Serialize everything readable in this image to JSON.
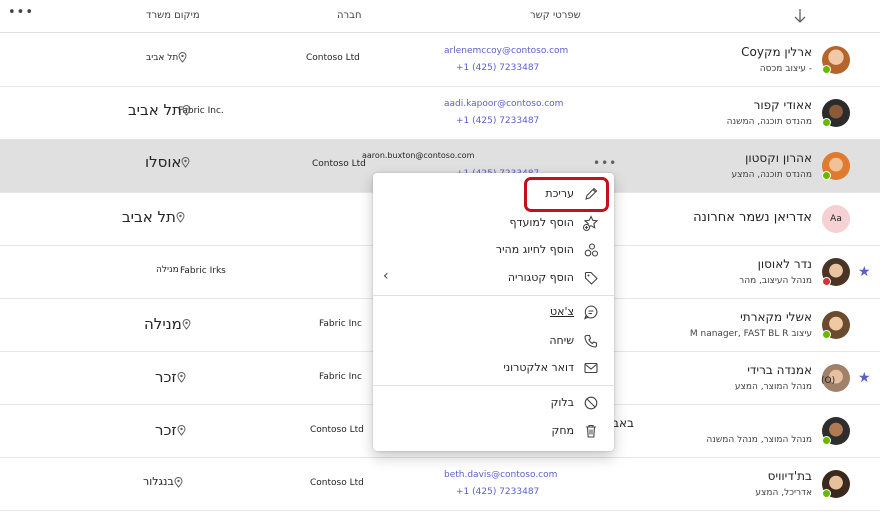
{
  "header": {
    "more_label": "•••",
    "location_col": "מיקום משרד",
    "company_col": "חברה",
    "contact_col": "שפרטי קשר"
  },
  "rows": [
    {
      "name": "ארלין מקCoy",
      "title": "- עיצוב מכסה",
      "email": "arlenemccoy@contoso.com",
      "phone": "+1 (425) 7233487",
      "company": "Contoso Ltd",
      "location": "תל אביב"
    },
    {
      "name": "אאודי קפור",
      "title": "מהנדס תוכנה, המשנה",
      "email": "aadi.kapoor@contoso.com",
      "phone": "+1 (425) 7233487",
      "company": "Fabric Inc.",
      "location": "תל אביב"
    },
    {
      "name": "אהרון וקסטון",
      "title": "מהנדס תוכנה, המצע",
      "email": "aaron.buxton@contoso.com",
      "phone": "+1 (425) 7233487",
      "company": "Contoso Ltd",
      "location": "אוסלו",
      "more": "•••"
    },
    {
      "name": "אדריאן נשמר אחרונה",
      "initials": "Aa",
      "location": "תל אביב"
    },
    {
      "name": "נדר לאוסון",
      "title": "מנהל העיצוב, מהר",
      "company": "Fabric Irks",
      "location": "מנילה"
    },
    {
      "name": "אשלי מקארתי",
      "title": "עיצוב M   nanager, FAST BL R",
      "company": "Fabric Inc",
      "location": "מנילה"
    },
    {
      "name": "אמנדה ברידי",
      "title": "מנהל המוצר, המצע",
      "company": "Fabric Inc",
      "location": "זכר",
      "extra": "(O)"
    },
    {
      "name": "באבר מביש",
      "title": "מנהל המוצר, מנהל המשנה",
      "company": "Contoso Ltd",
      "location": "זכר"
    },
    {
      "name": "בת'דיוויס",
      "title": "אדריכל, המצע",
      "email": "beth.davis@contoso.com",
      "phone": "+1 (425) 7233487",
      "company": "Contoso Ltd",
      "location": "בנגלור"
    }
  ],
  "menu": {
    "edit": "עריכת",
    "favorite": "הוסף למועדף",
    "speed_dial": "הוסף לחיוג מהיר",
    "category": "הוסף קטגוריה",
    "chat": "צ'אט",
    "call": "שיחה",
    "email": "דואר אלקטרוני",
    "block": "בלוק",
    "delete": "מחק"
  },
  "colors": {
    "accent": "#5b5fc7",
    "focus_ring": "#c50f1f",
    "selected_row": "#e0e0e0",
    "presence_available": "#6bb700",
    "presence_busy": "#d13438"
  },
  "icons": [
    "sort-down-arrow-icon",
    "location-pin-icon",
    "pencil-icon",
    "star-add-icon",
    "speed-dial-icon",
    "tag-icon",
    "chevron-left-icon",
    "chat-icon",
    "phone-icon",
    "mail-icon",
    "block-icon",
    "trash-icon",
    "favorite-star-icon"
  ]
}
